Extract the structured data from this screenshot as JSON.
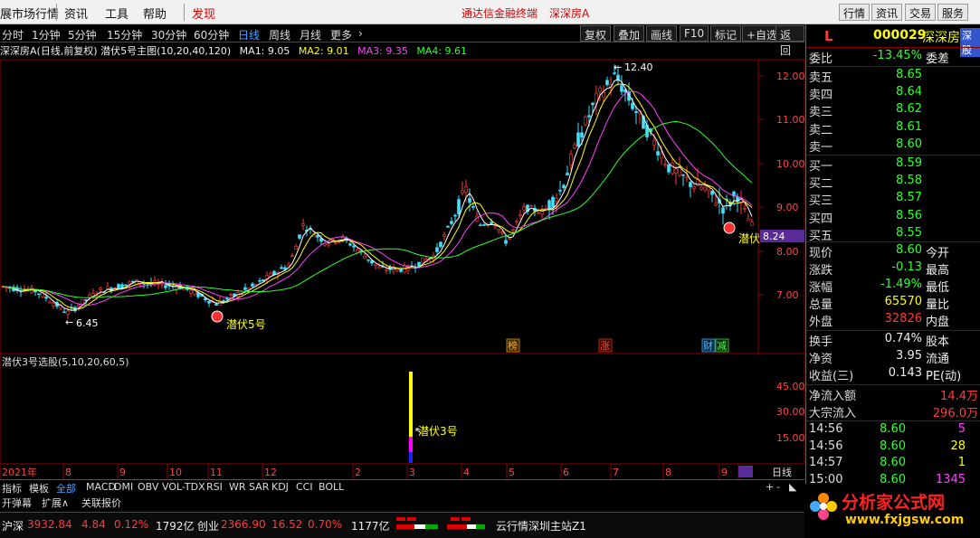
{
  "menubar": {
    "items": [
      "展市场行情",
      "行情",
      "资讯",
      "工具",
      "帮助"
    ],
    "discover": "发现",
    "promo1": "通达信金融终端",
    "promo2": "深深房A",
    "right_buttons": [
      "行情",
      "资讯",
      "交易",
      "服务"
    ]
  },
  "periodbar": {
    "periods": [
      "分时",
      "1分钟",
      "5分钟",
      "15分钟",
      "30分钟",
      "60分钟",
      "日线",
      "周线",
      "月线",
      "更多"
    ],
    "active": "日线",
    "tools": [
      "复权",
      "叠加",
      "画线",
      "F10",
      "标记",
      "+自选",
      "返回"
    ]
  },
  "main_chart": {
    "title": "深深房A(日线,前复权) 潜伏5号主图(10,20,40,120)",
    "ma1": "MA1: 9.05",
    "ma2": "MA2: 9.01",
    "ma3": "MA3: 9.35",
    "ma4": "MA4: 9.61",
    "high_label": "12.40",
    "low_label": "6.45",
    "signal_left": "潜伏5号",
    "signal_right": "潜伏",
    "price_tag": "8.24",
    "y_ticks": [
      "12.00",
      "11.00",
      "10.00",
      "9.00",
      "8.00",
      "7.00"
    ],
    "events": [
      "榜",
      "涨",
      "财",
      "减"
    ]
  },
  "sub_chart": {
    "title": "潜伏3号选股(5,10,20,60,5)",
    "signal": "潜伏3号",
    "y_ticks": [
      "45.00",
      "30.00",
      "15.00"
    ]
  },
  "x_axis": {
    "labels": [
      "2021年",
      "8",
      "9",
      "10",
      "11",
      "12",
      "2",
      "3",
      "4",
      "5",
      "6",
      "7",
      "8",
      "9",
      "--"
    ],
    "period": "日线"
  },
  "indicator_tabs": [
    "指标",
    "模板",
    "全部",
    "MACD",
    "DMI",
    "OBV",
    "VOL-TDX",
    "RSI",
    "WR",
    "SAR",
    "KDJ",
    "CCI",
    "BOLL"
  ],
  "bottom_tabs": [
    "开弹幕",
    "扩展∧",
    "关联报价"
  ],
  "statusbar": {
    "sh_name": "沪深",
    "sh_val": "3932.84",
    "sh_chg": "4.84",
    "sh_pct": "0.12%",
    "sh_amt": "1792亿",
    "cy_name": "创业",
    "cy_val": "2366.90",
    "cy_chg": "16.52",
    "cy_pct": "0.70%",
    "cy_amt": "1177亿",
    "server": "云行情深圳主站Z1"
  },
  "quote": {
    "flag": "L",
    "code": "000029",
    "name": "深深房A",
    "tag": "深股",
    "weibi_label": "委比",
    "weibi": "-13.45%",
    "weicha_label": "委差",
    "asks": [
      {
        "label": "卖五",
        "price": "8.65"
      },
      {
        "label": "卖四",
        "price": "8.64"
      },
      {
        "label": "卖三",
        "price": "8.62"
      },
      {
        "label": "卖二",
        "price": "8.61"
      },
      {
        "label": "卖一",
        "price": "8.60"
      }
    ],
    "bids": [
      {
        "label": "买一",
        "price": "8.59"
      },
      {
        "label": "买二",
        "price": "8.58"
      },
      {
        "label": "买三",
        "price": "8.57"
      },
      {
        "label": "买四",
        "price": "8.56"
      },
      {
        "label": "买五",
        "price": "8.55"
      }
    ],
    "stats": [
      {
        "label": "现价",
        "value": "8.60",
        "label2": "今开",
        "cls": "green"
      },
      {
        "label": "涨跌",
        "value": "-0.13",
        "label2": "最高",
        "cls": "green"
      },
      {
        "label": "涨幅",
        "value": "-1.49%",
        "label2": "最低",
        "cls": "green"
      },
      {
        "label": "总量",
        "value": "65570",
        "label2": "量比",
        "cls": "yellow"
      },
      {
        "label": "外盘",
        "value": "32826",
        "label2": "内盘",
        "cls": "red"
      }
    ],
    "stats2": [
      {
        "label": "换手",
        "value": "0.74%",
        "label2": "股本"
      },
      {
        "label": "净资",
        "value": "3.95",
        "label2": "流通"
      },
      {
        "label": "收益(三)",
        "value": "0.143",
        "label2": "PE(动)"
      }
    ],
    "flow": [
      {
        "label": "净流入额",
        "value": "14.4万"
      },
      {
        "label": "大宗流入",
        "value": "296.0万"
      }
    ],
    "ticks": [
      {
        "time": "14:56",
        "price": "8.60",
        "vol": "5",
        "cls": "magenta"
      },
      {
        "time": "14:56",
        "price": "8.60",
        "vol": "28",
        "cls": "yellow"
      },
      {
        "time": "14:57",
        "price": "8.60",
        "vol": "1",
        "cls": "yellow"
      },
      {
        "time": "15:00",
        "price": "8.60",
        "vol": "1345",
        "cls": "magenta"
      }
    ]
  },
  "logo": {
    "name": "分析家公式网",
    "url": "www.fxjgsw.com"
  },
  "colors": {
    "up": "#ff3a3a",
    "down": "#40e0ff",
    "ma1": "#ffffff",
    "ma2": "#ffff00",
    "ma3": "#ff40ff",
    "ma4": "#2fff2f"
  }
}
